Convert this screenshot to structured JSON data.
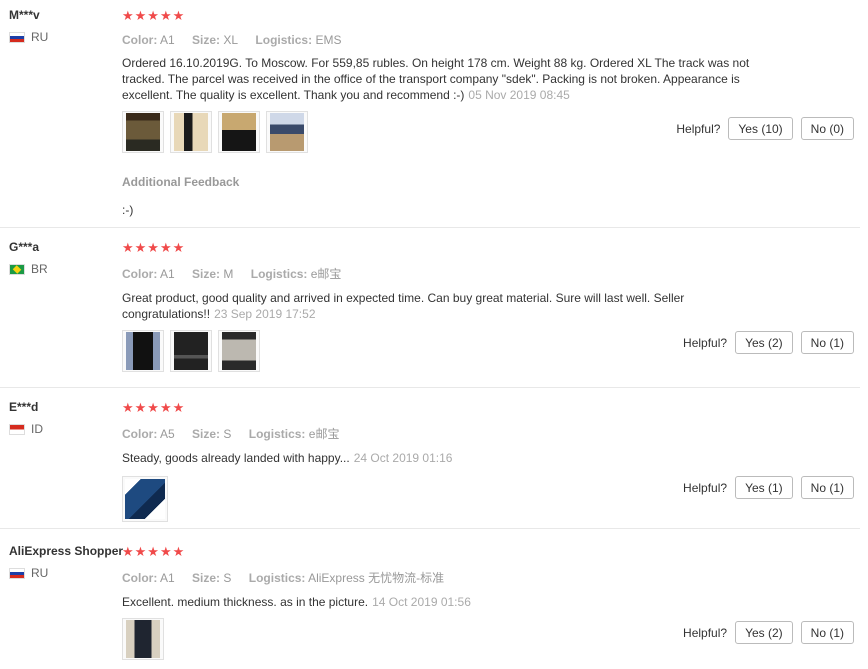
{
  "helpful_label": "Helpful?",
  "reviews": [
    {
      "user": "M***v",
      "country": "RU",
      "rating": "★★★★★",
      "color_label": "Color:",
      "color": "A1",
      "size_label": "Size:",
      "size": "XL",
      "logistics_label": "Logistics:",
      "logistics": "EMS",
      "text": "Ordered 16.10.2019G. To Moscow. For 559,85 rubles. On height 178 cm. Weight 88 kg. Ordered XL The track was not tracked. The parcel was received in the office of the transport company \"sdek\". Packing is not broken. Appearance is excellent. The quality is excellent. Thank you and recommend :-)",
      "date": "05 Nov 2019 08:45",
      "yes": "Yes (10)",
      "no": "No (0)",
      "additional_label": "Additional Feedback",
      "additional_text": ":-)"
    },
    {
      "user": "G***a",
      "country": "BR",
      "rating": "★★★★★",
      "color_label": "Color:",
      "color": "A1",
      "size_label": "Size:",
      "size": "M",
      "logistics_label": "Logistics:",
      "logistics": "e邮宝",
      "text": "Great product, good quality and arrived in expected time. Can buy great material. Sure will last well. Seller congratulations!!",
      "date": "23 Sep 2019 17:52",
      "yes": "Yes (2)",
      "no": "No (1)"
    },
    {
      "user": "E***d",
      "country": "ID",
      "rating": "★★★★★",
      "color_label": "Color:",
      "color": "A5",
      "size_label": "Size:",
      "size": "S",
      "logistics_label": "Logistics:",
      "logistics": "e邮宝",
      "text": "Steady, goods already landed with happy...",
      "date": "24 Oct 2019 01:16",
      "yes": "Yes (1)",
      "no": "No (1)"
    },
    {
      "user": "AliExpress Shopper",
      "country": "RU",
      "rating": "★★★★★",
      "color_label": "Color:",
      "color": "A1",
      "size_label": "Size:",
      "size": "S",
      "logistics_label": "Logistics:",
      "logistics": "AliExpress 无忧物流-标准",
      "text": "Excellent. medium thickness. as in the picture.",
      "date": "14 Oct 2019 01:56",
      "yes": "Yes (2)",
      "no": "No (1)"
    }
  ]
}
